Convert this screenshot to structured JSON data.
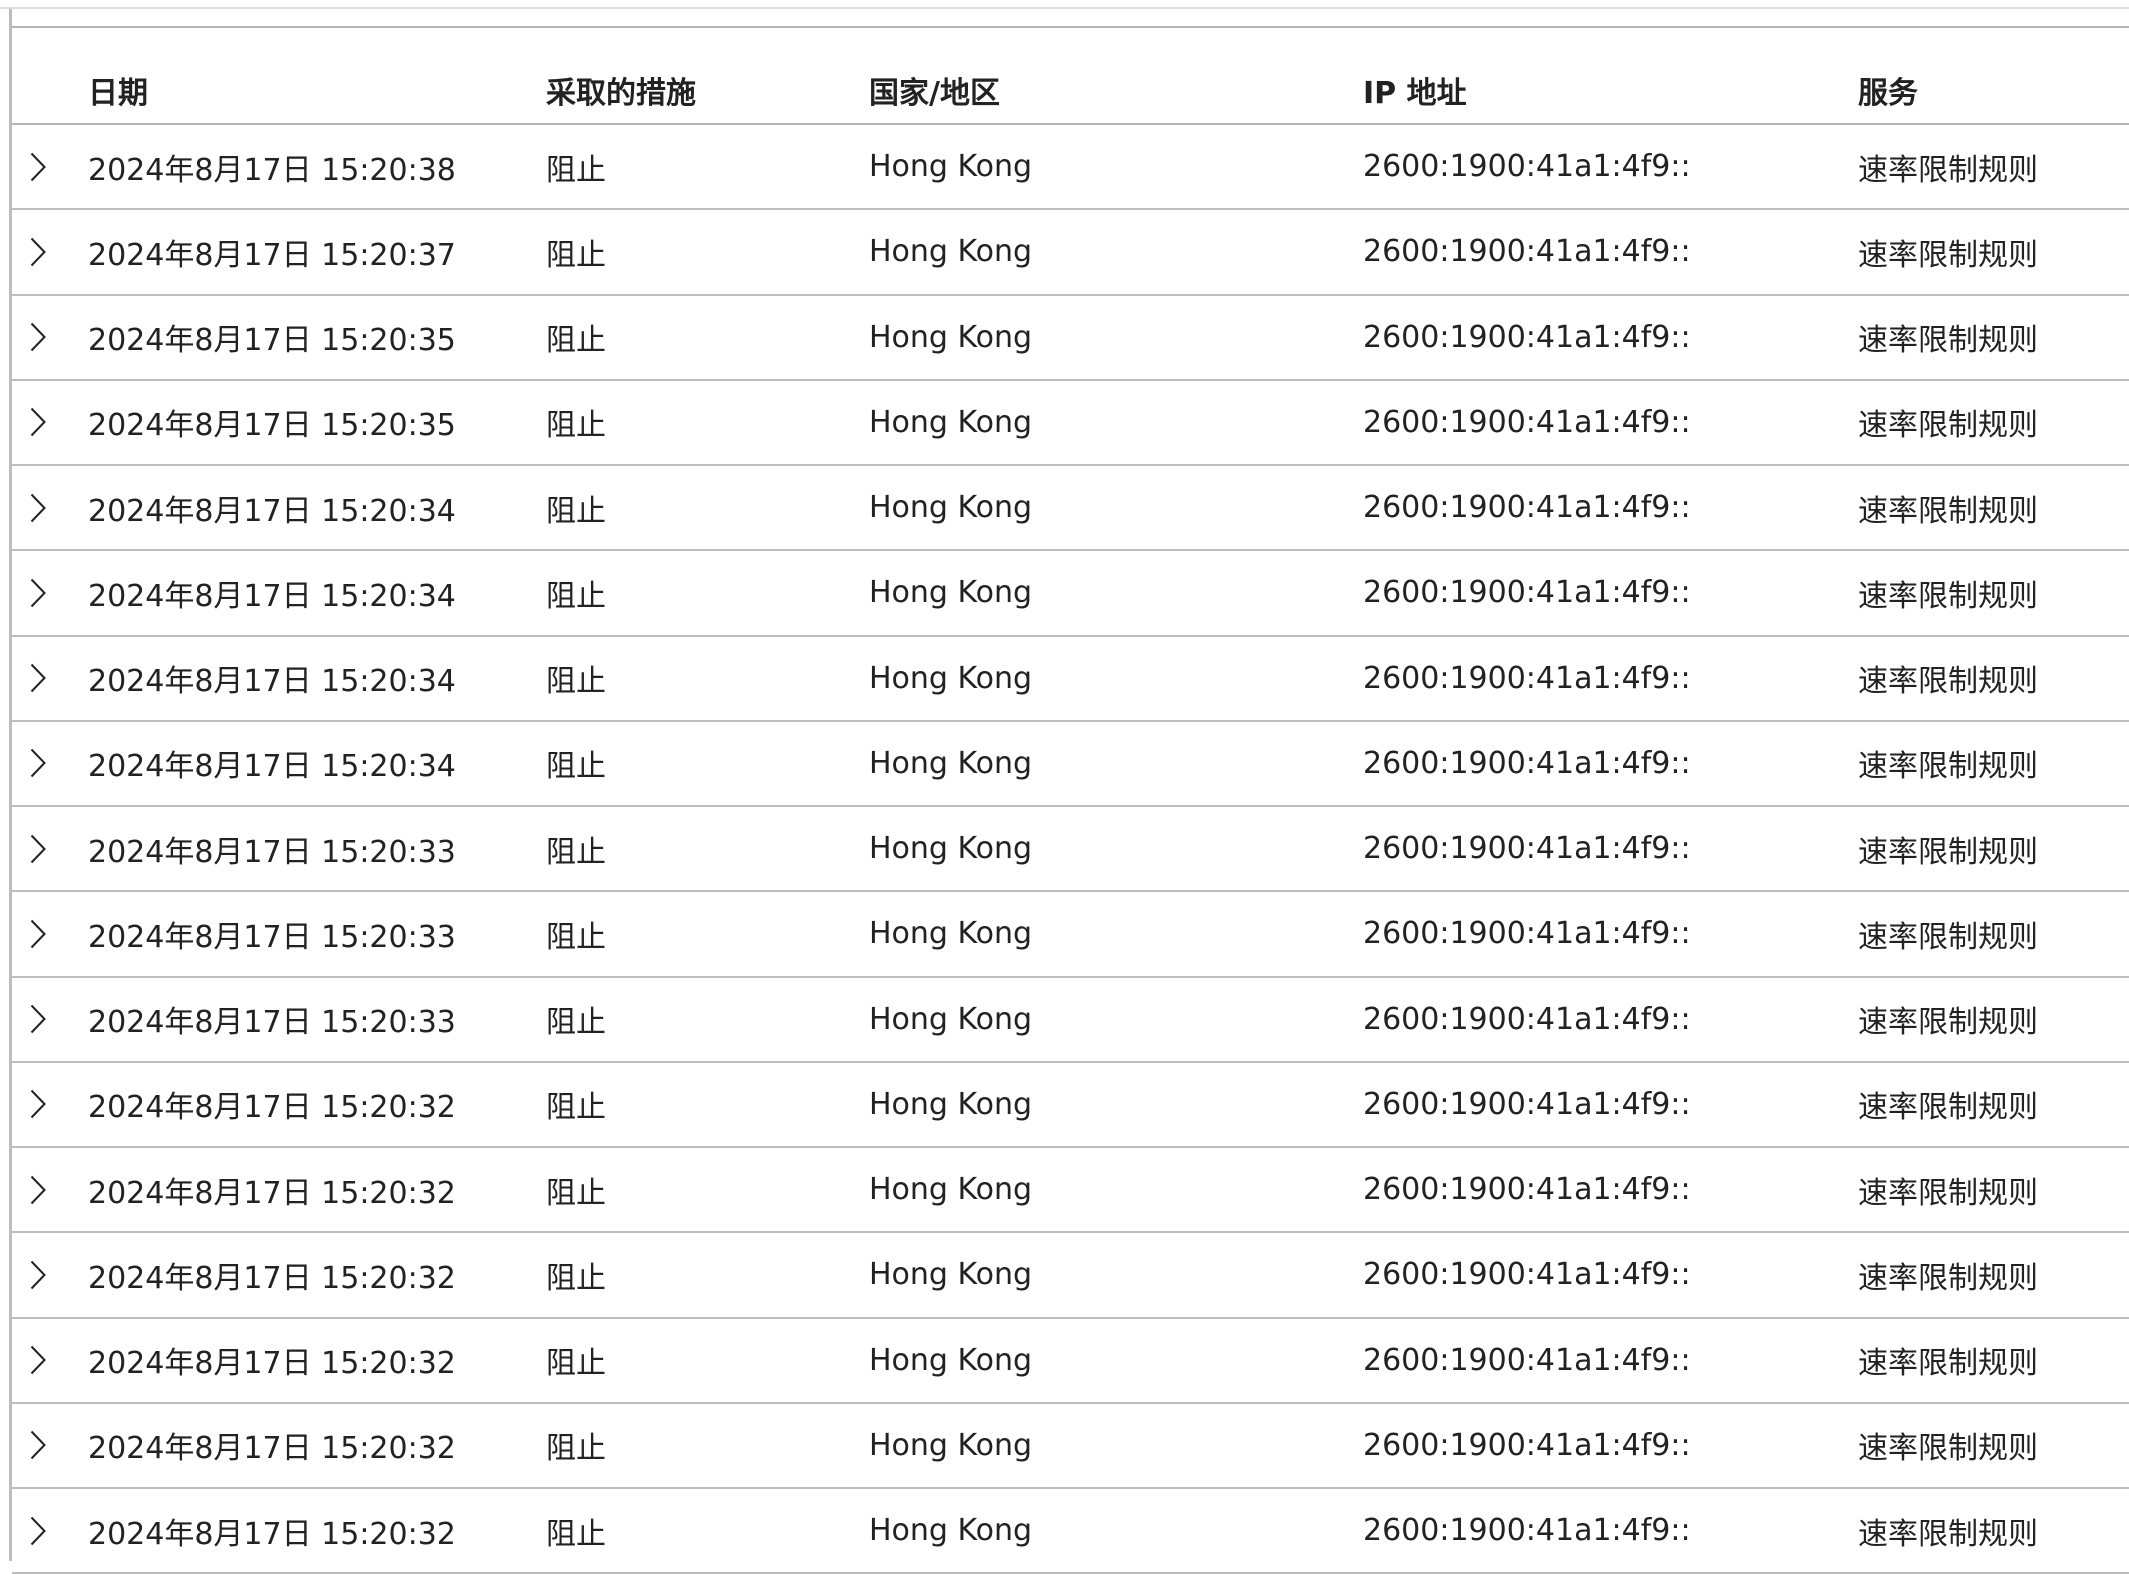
{
  "table": {
    "columns": {
      "date": "日期",
      "action": "采取的措施",
      "country": "国家/地区",
      "ip": "IP 地址",
      "service": "服务"
    },
    "expand_icon": "chevron-right-icon",
    "rows": [
      {
        "date": "2024年8月17日 15:20:38",
        "action": "阻止",
        "country": "Hong Kong",
        "ip": "2600:1900:41a1:4f9::",
        "service": "速率限制规则"
      },
      {
        "date": "2024年8月17日 15:20:37",
        "action": "阻止",
        "country": "Hong Kong",
        "ip": "2600:1900:41a1:4f9::",
        "service": "速率限制规则"
      },
      {
        "date": "2024年8月17日 15:20:35",
        "action": "阻止",
        "country": "Hong Kong",
        "ip": "2600:1900:41a1:4f9::",
        "service": "速率限制规则"
      },
      {
        "date": "2024年8月17日 15:20:35",
        "action": "阻止",
        "country": "Hong Kong",
        "ip": "2600:1900:41a1:4f9::",
        "service": "速率限制规则"
      },
      {
        "date": "2024年8月17日 15:20:34",
        "action": "阻止",
        "country": "Hong Kong",
        "ip": "2600:1900:41a1:4f9::",
        "service": "速率限制规则"
      },
      {
        "date": "2024年8月17日 15:20:34",
        "action": "阻止",
        "country": "Hong Kong",
        "ip": "2600:1900:41a1:4f9::",
        "service": "速率限制规则"
      },
      {
        "date": "2024年8月17日 15:20:34",
        "action": "阻止",
        "country": "Hong Kong",
        "ip": "2600:1900:41a1:4f9::",
        "service": "速率限制规则"
      },
      {
        "date": "2024年8月17日 15:20:34",
        "action": "阻止",
        "country": "Hong Kong",
        "ip": "2600:1900:41a1:4f9::",
        "service": "速率限制规则"
      },
      {
        "date": "2024年8月17日 15:20:33",
        "action": "阻止",
        "country": "Hong Kong",
        "ip": "2600:1900:41a1:4f9::",
        "service": "速率限制规则"
      },
      {
        "date": "2024年8月17日 15:20:33",
        "action": "阻止",
        "country": "Hong Kong",
        "ip": "2600:1900:41a1:4f9::",
        "service": "速率限制规则"
      },
      {
        "date": "2024年8月17日 15:20:33",
        "action": "阻止",
        "country": "Hong Kong",
        "ip": "2600:1900:41a1:4f9::",
        "service": "速率限制规则"
      },
      {
        "date": "2024年8月17日 15:20:32",
        "action": "阻止",
        "country": "Hong Kong",
        "ip": "2600:1900:41a1:4f9::",
        "service": "速率限制规则"
      },
      {
        "date": "2024年8月17日 15:20:32",
        "action": "阻止",
        "country": "Hong Kong",
        "ip": "2600:1900:41a1:4f9::",
        "service": "速率限制规则"
      },
      {
        "date": "2024年8月17日 15:20:32",
        "action": "阻止",
        "country": "Hong Kong",
        "ip": "2600:1900:41a1:4f9::",
        "service": "速率限制规则"
      },
      {
        "date": "2024年8月17日 15:20:32",
        "action": "阻止",
        "country": "Hong Kong",
        "ip": "2600:1900:41a1:4f9::",
        "service": "速率限制规则"
      },
      {
        "date": "2024年8月17日 15:20:32",
        "action": "阻止",
        "country": "Hong Kong",
        "ip": "2600:1900:41a1:4f9::",
        "service": "速率限制规则"
      },
      {
        "date": "2024年8月17日 15:20:32",
        "action": "阻止",
        "country": "Hong Kong",
        "ip": "2600:1900:41a1:4f9::",
        "service": "速率限制规则"
      }
    ]
  }
}
